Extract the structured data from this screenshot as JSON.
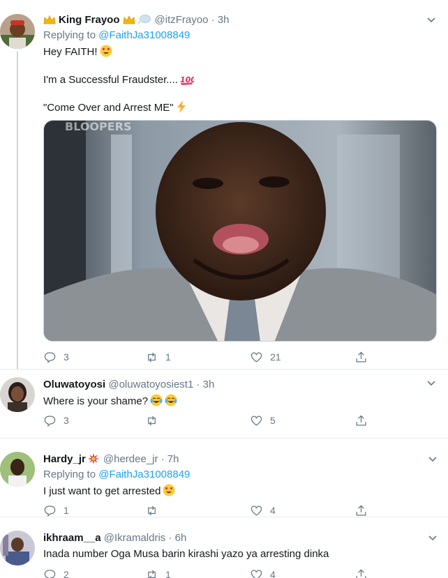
{
  "tweets": [
    {
      "name": "King Frayoo",
      "handle": "@itzFrayoo · 3h",
      "replying_prefix": "Replying to",
      "replying_to": "@FaithJa31008849",
      "lines": [
        "Hey FAITH!",
        "I'm a Successful Fraudster....",
        "\"Come Over and Arrest ME\""
      ],
      "media_watermark": "BLOOPERS",
      "replies": "3",
      "retweets": "1",
      "likes": "21"
    },
    {
      "name": "Oluwatoyosi",
      "handle": "@oluwatoyosiest1 · 3h",
      "lines": [
        "Where is your shame?"
      ],
      "replies": "3",
      "retweets": "",
      "likes": "5"
    },
    {
      "name": "Hardy_jr",
      "handle": "@herdee_jr · 7h",
      "replying_prefix": "Replying to",
      "replying_to": "@FaithJa31008849",
      "lines": [
        "I just want to get arrested"
      ],
      "replies": "1",
      "retweets": "",
      "likes": "4"
    },
    {
      "name": "ikhraam__a",
      "handle": "@Ikramaldris · 6h",
      "lines": [
        "Inada number Oga Musa barin kirashi yazo ya arresting dinka"
      ],
      "replies": "2",
      "retweets": "1",
      "likes": "4"
    }
  ],
  "icons": {
    "reply": "reply-icon",
    "retweet": "retweet-icon",
    "like": "heart-icon",
    "share": "share-icon",
    "more": "chevron-down-icon"
  },
  "colors": {
    "link": "#1da1f2",
    "secondary": "#657786",
    "border": "#e6ecf0"
  }
}
